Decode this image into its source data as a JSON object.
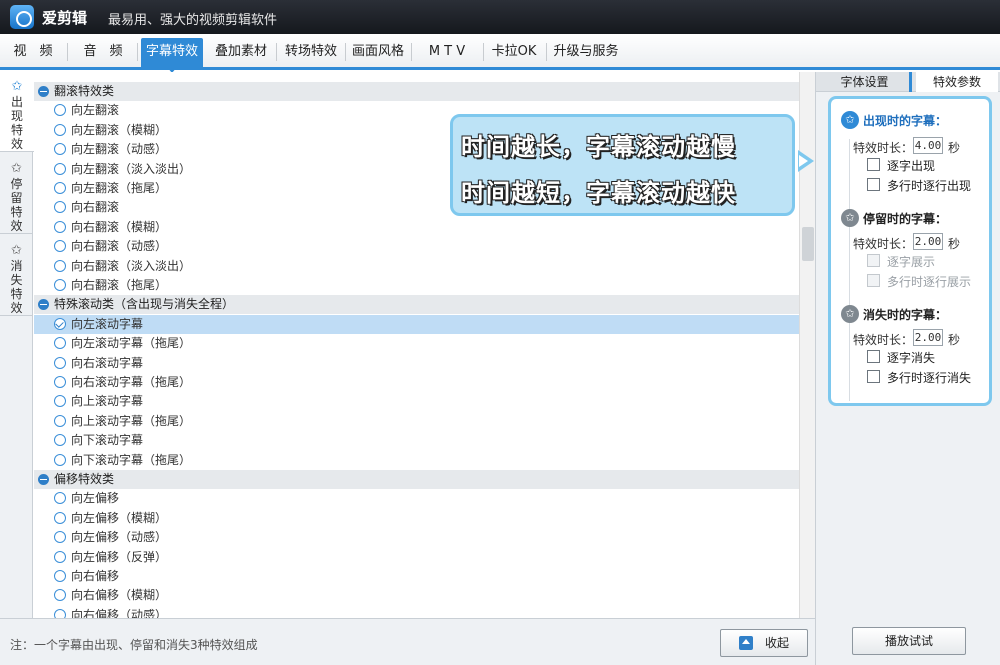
{
  "app": {
    "title": "爱剪辑",
    "slogan": "最易用、强大的视频剪辑软件"
  },
  "menu": [
    "视　频",
    "音　频",
    "字幕特效",
    "叠加素材",
    "转场特效",
    "画面风格",
    "M T V",
    "卡拉OK",
    "升级与服务"
  ],
  "menu_active": "字幕特效",
  "side_tabs": [
    {
      "label": "出现特效",
      "icon": "✩"
    },
    {
      "label": "停留特效",
      "icon": "✩"
    },
    {
      "label": "消失特效",
      "icon": "✩"
    }
  ],
  "effect_list": {
    "groups": [
      {
        "title": "翻滚特效类",
        "items": [
          "向左翻滚",
          "向左翻滚（模糊）",
          "向左翻滚（动感）",
          "向左翻滚（淡入淡出）",
          "向左翻滚（拖尾）",
          "向右翻滚",
          "向右翻滚（模糊）",
          "向右翻滚（动感）",
          "向右翻滚（淡入淡出）",
          "向右翻滚（拖尾）"
        ]
      },
      {
        "title": "特殊滚动类（含出现与消失全程）",
        "items": [
          "向左滚动字幕",
          "向左滚动字幕（拖尾）",
          "向右滚动字幕",
          "向右滚动字幕（拖尾）",
          "向上滚动字幕",
          "向上滚动字幕（拖尾）",
          "向下滚动字幕",
          "向下滚动字幕（拖尾）"
        ]
      },
      {
        "title": "偏移特效类",
        "items": [
          "向左偏移",
          "向左偏移（模糊）",
          "向左偏移（动感）",
          "向左偏移（反弹）",
          "向右偏移",
          "向右偏移（模糊）",
          "向右偏移（动感）"
        ]
      }
    ],
    "selected": "向左滚动字幕"
  },
  "right_panel": {
    "tabs": [
      "字体设置",
      "特效参数"
    ],
    "sections": [
      {
        "title": "出现时的字幕：",
        "duration_label": "特效时长：",
        "duration": "4.00",
        "unit": "秒",
        "options": [
          {
            "label": "逐字出现",
            "enabled": true
          },
          {
            "label": "多行时逐行出现",
            "enabled": true
          }
        ]
      },
      {
        "title": "停留时的字幕：",
        "duration_label": "特效时长：",
        "duration": "2.00",
        "unit": "秒",
        "options": [
          {
            "label": "逐字展示",
            "enabled": false
          },
          {
            "label": "多行时逐行展示",
            "enabled": false
          }
        ]
      },
      {
        "title": "消失时的字幕：",
        "duration_label": "特效时长：",
        "duration": "2.00",
        "unit": "秒",
        "options": [
          {
            "label": "逐字消失",
            "enabled": true
          },
          {
            "label": "多行时逐行消失",
            "enabled": true
          }
        ]
      }
    ]
  },
  "callout": {
    "lines": [
      "时间越长，字幕滚动越慢",
      "时间越短，字幕滚动越快"
    ]
  },
  "bottom": {
    "note": "注：一个字幕由出现、停留和消失3种特效组成",
    "collapse_label": "收起",
    "play_label": "播放试试"
  },
  "colors": {
    "accent": "#2f8ad6",
    "callout_border": "#7ec8ee",
    "selected_row": "#bfdcf5"
  }
}
